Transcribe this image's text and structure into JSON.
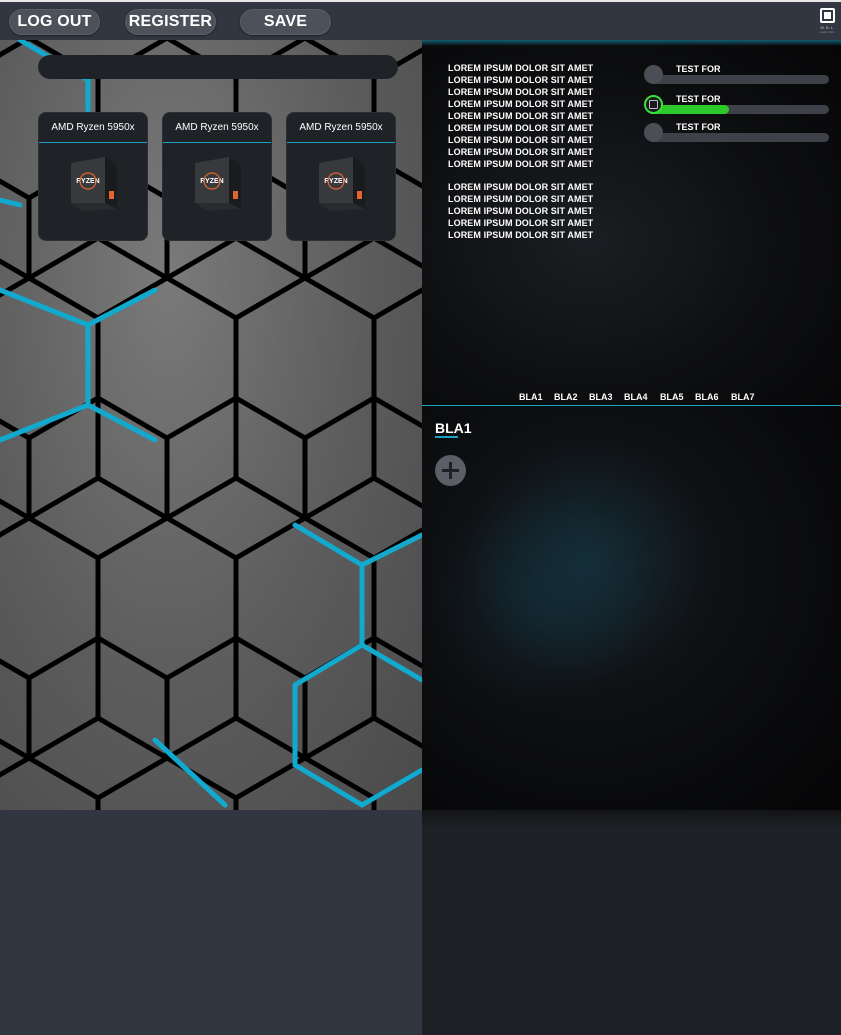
{
  "topbar": {
    "logout_label": "LOG OUT",
    "register_label": "REGISTER",
    "save_label": "SAVE",
    "logo_text": "M.B.L",
    "logo_sub": "studio 2021"
  },
  "products": [
    {
      "name": "AMD Ryzen 5950x",
      "image": "amd-ryzen-box"
    },
    {
      "name": "AMD Ryzen 5950x",
      "image": "amd-ryzen-box"
    },
    {
      "name": "AMD Ryzen 5950x",
      "image": "amd-ryzen-box"
    }
  ],
  "info": {
    "block1": [
      "LOREM IPSUM DOLOR SIT AMET",
      "LOREM IPSUM DOLOR SIT AMET",
      "LOREM IPSUM DOLOR SIT AMET",
      "LOREM IPSUM DOLOR SIT AMET",
      "LOREM IPSUM DOLOR SIT AMET",
      "LOREM IPSUM DOLOR SIT AMET",
      "LOREM IPSUM DOLOR SIT AMET",
      "LOREM IPSUM DOLOR SIT AMET",
      "LOREM IPSUM DOLOR SIT AMET"
    ],
    "block2": [
      "LOREM IPSUM DOLOR SIT AMET",
      "LOREM IPSUM DOLOR SIT AMET",
      "LOREM IPSUM DOLOR SIT AMET",
      "LOREM IPSUM DOLOR SIT AMET",
      "LOREM IPSUM DOLOR SIT AMET"
    ]
  },
  "sliders": [
    {
      "label": "TEST FOR",
      "value": 0.0,
      "active": false
    },
    {
      "label": "TEST FOR",
      "value": 0.45,
      "active": true
    },
    {
      "label": "TEST FOR",
      "value": 0.0,
      "active": false
    }
  ],
  "tabs": [
    "BLA1",
    "BLA2",
    "BLA3",
    "BLA4",
    "BLA5",
    "BLA6",
    "BLA7"
  ],
  "section": {
    "title": "BLA1",
    "add_icon": "plus-circle-icon"
  },
  "colors": {
    "accent": "#1ba3c6",
    "slider_on": "#2dc92a",
    "panel": "#1f2226",
    "topbar": "#323640"
  }
}
